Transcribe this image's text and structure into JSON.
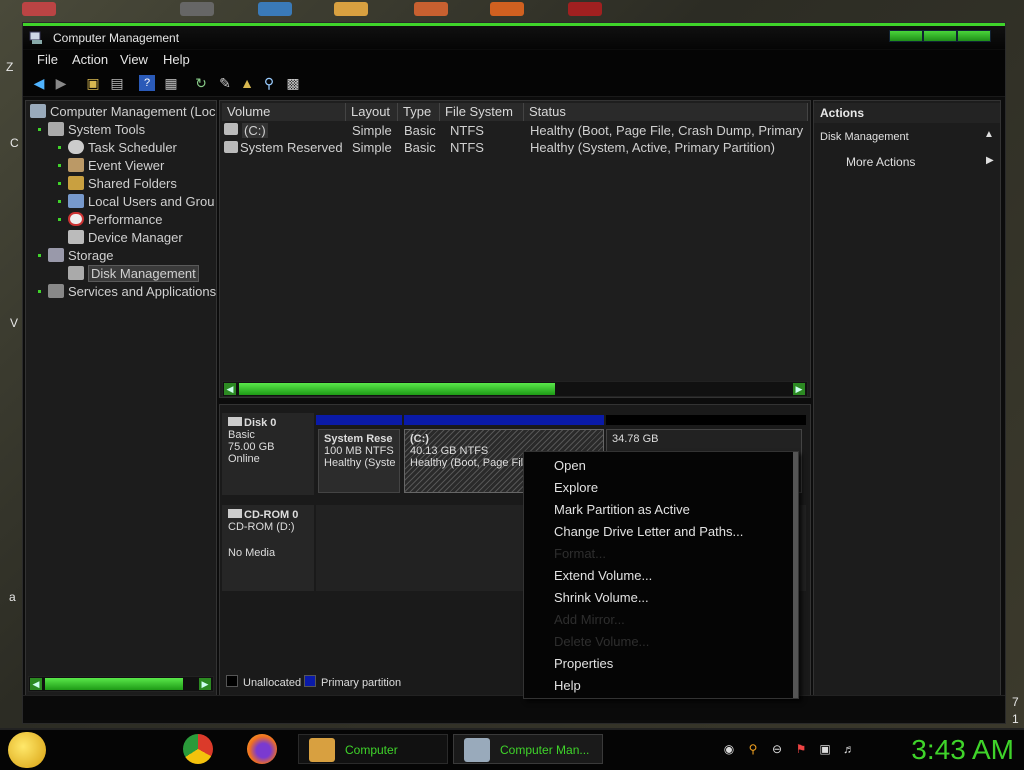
{
  "window": {
    "title": "Computer Management"
  },
  "menu": [
    "File",
    "Action",
    "View",
    "Help"
  ],
  "tree": {
    "root": "Computer Management (Loc",
    "items": [
      {
        "label": "System Tools",
        "icon": "tools-icon"
      },
      {
        "label": "Task Scheduler",
        "icon": "clock-icon"
      },
      {
        "label": "Event Viewer",
        "icon": "event-viewer-icon"
      },
      {
        "label": "Shared Folders",
        "icon": "shared-folder-icon"
      },
      {
        "label": "Local Users and Grou",
        "icon": "users-icon"
      },
      {
        "label": "Performance",
        "icon": "performance-icon"
      },
      {
        "label": "Device Manager",
        "icon": "device-manager-icon"
      },
      {
        "label": "Storage",
        "icon": "storage-icon"
      },
      {
        "label": "Disk Management",
        "icon": "disk-icon"
      },
      {
        "label": "Services and Applications",
        "icon": "services-icon"
      }
    ]
  },
  "volumes": {
    "columns": [
      "Volume",
      "Layout",
      "Type",
      "File System",
      "Status"
    ],
    "rows": [
      {
        "volume": "(C:)",
        "layout": "Simple",
        "type": "Basic",
        "fs": "NTFS",
        "status": "Healthy (Boot, Page File, Crash Dump, Primary"
      },
      {
        "volume": "System Reserved",
        "layout": "Simple",
        "type": "Basic",
        "fs": "NTFS",
        "status": "Healthy (System, Active, Primary Partition)"
      }
    ]
  },
  "disks": {
    "disk0": {
      "name": "Disk 0",
      "type": "Basic",
      "size": "75.00 GB",
      "state": "Online"
    },
    "cdrom0": {
      "name": "CD-ROM 0",
      "type": "CD-ROM (D:)",
      "state": "No Media"
    },
    "partitions": [
      {
        "name": "System Rese",
        "size": "100 MB NTFS",
        "status": "Healthy (Syste"
      },
      {
        "name": "(C:)",
        "size": "40.13 GB NTFS",
        "status": "Healthy (Boot, Page File"
      },
      {
        "name": "",
        "size": "34.78 GB",
        "status": ""
      }
    ]
  },
  "legend": {
    "unallocated": "Unallocated",
    "primary": "Primary partition"
  },
  "actions": {
    "header": "Actions",
    "section": "Disk Management",
    "more": "More Actions"
  },
  "context_menu": [
    {
      "label": "Open",
      "enabled": true
    },
    {
      "label": "Explore",
      "enabled": true
    },
    {
      "label": "Mark Partition as Active",
      "enabled": true
    },
    {
      "label": "Change Drive Letter and Paths...",
      "enabled": true
    },
    {
      "label": "Format...",
      "enabled": false
    },
    {
      "label": "Extend Volume...",
      "enabled": true
    },
    {
      "label": "Shrink Volume...",
      "enabled": true
    },
    {
      "label": "Add Mirror...",
      "enabled": false
    },
    {
      "label": "Delete Volume...",
      "enabled": false
    },
    {
      "label": "Properties",
      "enabled": true
    },
    {
      "label": "Help",
      "enabled": true
    }
  ],
  "taskbar": {
    "items": [
      {
        "label": "Computer"
      },
      {
        "label": "Computer Man..."
      }
    ],
    "clock": "3:43 AM"
  },
  "desktop_edge": [
    "Z",
    "C",
    "V",
    "a",
    "7",
    "1"
  ],
  "colors": {
    "accent": "#3fd42a",
    "primary_partition": "#0a1aa8",
    "unallocated": "#000000"
  }
}
